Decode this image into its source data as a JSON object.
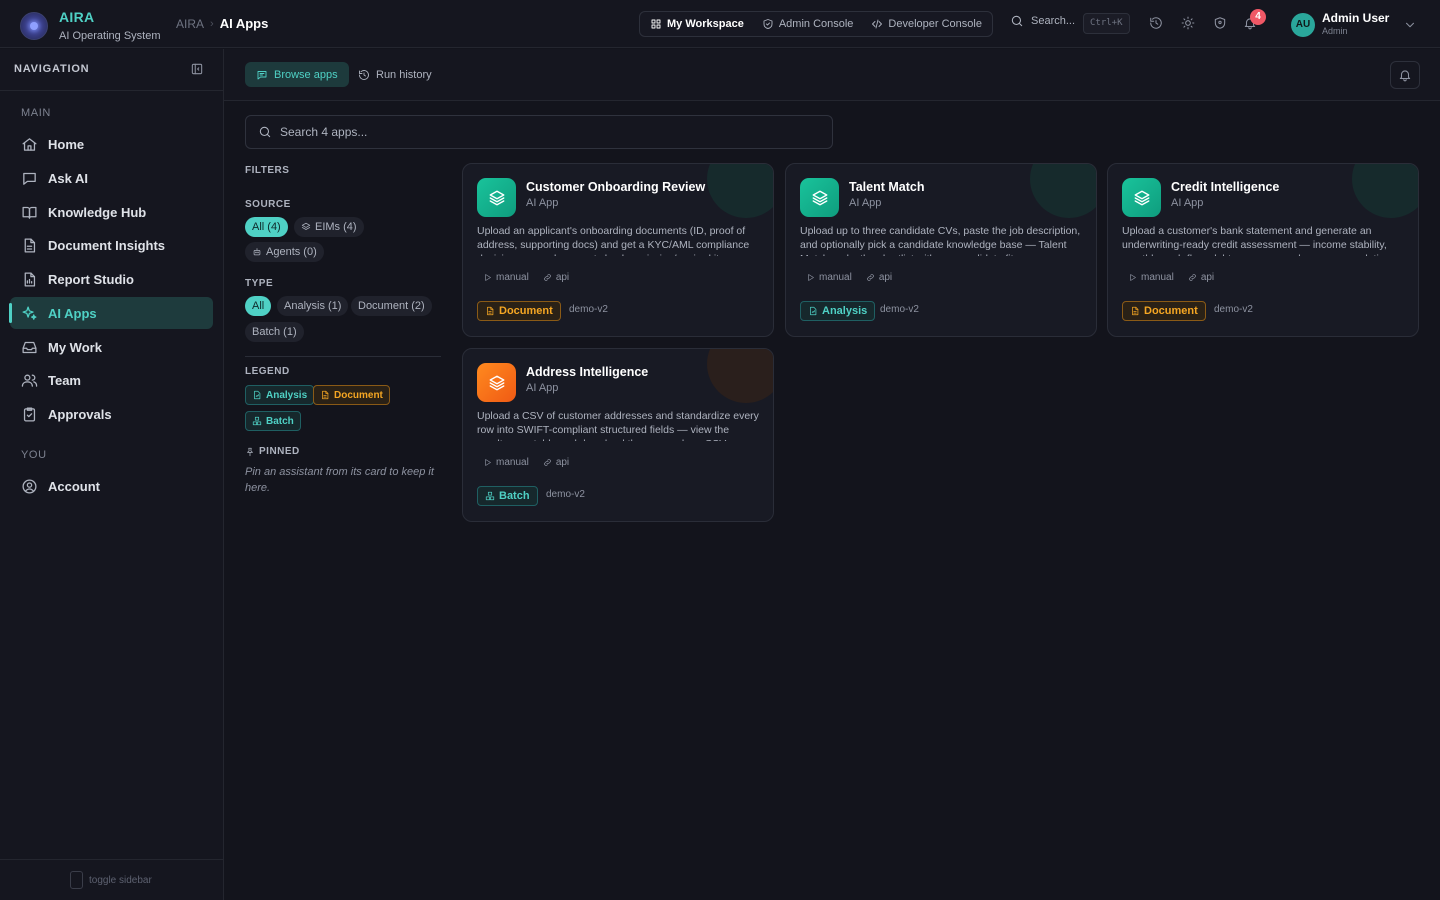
{
  "brand": {
    "name": "AIRA",
    "subtitle": "AI Operating System"
  },
  "breadcrumb": {
    "root": "AIRA",
    "current": "AI Apps"
  },
  "workspace_switch": [
    "My Workspace",
    "Admin Console",
    "Developer Console"
  ],
  "search": {
    "label": "Search...",
    "shortcut": "Ctrl+K"
  },
  "notifications": {
    "count": "4"
  },
  "user": {
    "initials": "AU",
    "name": "Admin User",
    "role": "Admin"
  },
  "sidebar": {
    "heading": "NAVIGATION",
    "group_main": "MAIN",
    "group_you": "YOU",
    "items": [
      "Home",
      "Ask AI",
      "Knowledge Hub",
      "Document Insights",
      "Report Studio",
      "AI Apps",
      "My Work",
      "Team",
      "Approvals",
      "Account"
    ],
    "toggle_hint": "toggle sidebar"
  },
  "tabs": {
    "browse": "Browse apps",
    "history": "Run history"
  },
  "app_search": {
    "placeholder": "Search 4 apps..."
  },
  "filters": {
    "title": "FILTERS",
    "source_label": "SOURCE",
    "source": [
      "All (4)",
      "EIMs (4)",
      "Agents (0)"
    ],
    "type_label": "TYPE",
    "type": [
      "All",
      "Analysis (1)",
      "Document (2)",
      "Batch (1)"
    ],
    "legend_label": "LEGEND",
    "legend": [
      "Analysis",
      "Document",
      "Batch"
    ],
    "pinned_label": "PINNED",
    "pinned_hint": "Pin an assistant from its card to keep it here."
  },
  "apps": [
    {
      "title": "Customer Onboarding Review",
      "kind": "AI App",
      "description": "Upload an applicant's onboarding documents (ID, proof of address, supporting docs) and get a KYC/AML compliance decision — per-document checks, missing/expired items",
      "triggers": [
        "manual",
        "api"
      ],
      "tag": "Document",
      "env": "demo-v2"
    },
    {
      "title": "Talent Match",
      "kind": "AI App",
      "description": "Upload up to three candidate CVs, paste the job description, and optionally pick a candidate knowledge base — Talent Match ranks the shortlist with per-candidate fit scores",
      "triggers": [
        "manual",
        "api"
      ],
      "tag": "Analysis",
      "env": "demo-v2"
    },
    {
      "title": "Credit Intelligence",
      "kind": "AI App",
      "description": "Upload a customer's bank statement and generate an underwriting-ready credit assessment — income stability, monthly cash flow, debt exposure, and a recommendation",
      "triggers": [
        "manual",
        "api"
      ],
      "tag": "Document",
      "env": "demo-v2"
    },
    {
      "title": "Address Intelligence",
      "kind": "AI App",
      "description": "Upload a CSV of customer addresses and standardize every row into SWIFT-compliant structured fields — view the results as a table and download them as a clean CSV",
      "triggers": [
        "manual",
        "api"
      ],
      "tag": "Batch",
      "env": "demo-v2"
    }
  ],
  "colors": {
    "accent": "#4fd1c5",
    "document": "#f5a623",
    "badge": "#f05866",
    "app_icon_green": "#19c39b",
    "app_icon_orange": "#ff8a1f"
  }
}
